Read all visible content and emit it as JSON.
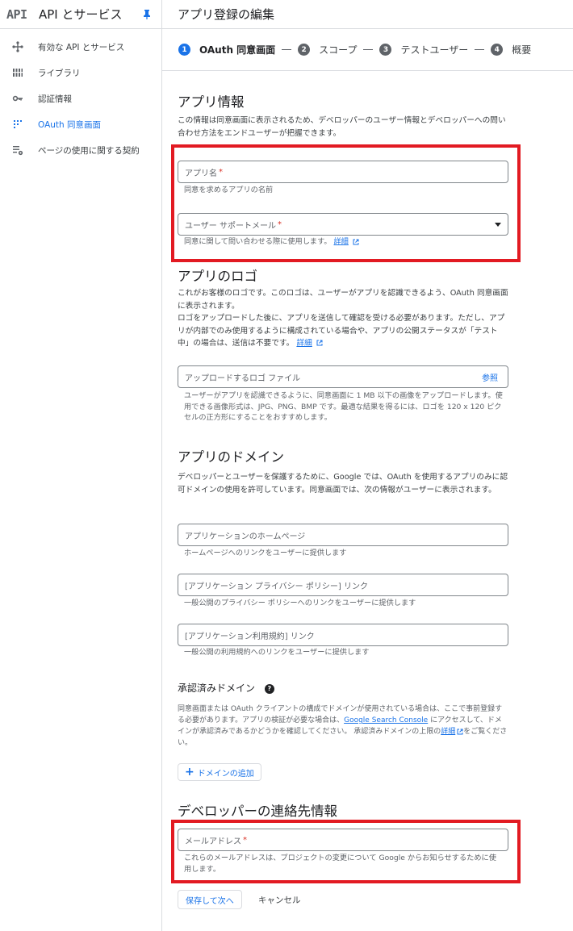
{
  "sidebar": {
    "logo": "API",
    "title": "API とサービス",
    "items": [
      {
        "label": "有効な API とサービス",
        "icon": "diamond-icon",
        "active": false
      },
      {
        "label": "ライブラリ",
        "icon": "library-icon",
        "active": false
      },
      {
        "label": "認証情報",
        "icon": "key-icon",
        "active": false
      },
      {
        "label": "OAuth 同意画面",
        "icon": "consent-icon",
        "active": true
      },
      {
        "label": "ページの使用に関する契約",
        "icon": "settings-list-icon",
        "active": false
      }
    ]
  },
  "header": {
    "title": "アプリ登録の編集"
  },
  "stepper": {
    "steps": [
      {
        "num": "1",
        "label": "OAuth 同意画面"
      },
      {
        "num": "2",
        "label": "スコープ"
      },
      {
        "num": "3",
        "label": "テストユーザー"
      },
      {
        "num": "4",
        "label": "概要"
      }
    ]
  },
  "app_info": {
    "heading": "アプリ情報",
    "desc": "この情報は同意画面に表示されるため、デベロッパーのユーザー情報とデベロッパーへの問い合わせ方法をエンドユーザーが把握できます。",
    "app_name_placeholder": "アプリ名",
    "app_name_hint": "同意を求めるアプリの名前",
    "support_email_placeholder": "ユーザー サポートメール",
    "support_email_hint": "同意に関して問い合わせる際に使用します。",
    "details_link": "詳細",
    "required_mark": "*"
  },
  "app_logo": {
    "heading": "アプリのロゴ",
    "desc_line1": "これがお客様のロゴです。このロゴは、ユーザーがアプリを認識できるよう、OAuth 同意画面に表示されます。",
    "desc_line2": "ロゴをアップロードした後に、アプリを送信して確認を受ける必要があります。ただし、アプリが内部でのみ使用するように構成されている場合や、アプリの公開ステータスが「テスト中」の場合は、送信は不要です。",
    "details_link": "詳細",
    "upload_placeholder": "アップロードするロゴ ファイル",
    "browse": "参照",
    "hint": "ユーザーがアプリを認識できるように、同意画面に 1 MB 以下の画像をアップロードします。使用できる画像形式は、JPG、PNG、BMP です。最適な結果を得るには、ロゴを 120 x 120 ピクセルの正方形にすることをおすすめします。"
  },
  "app_domain": {
    "heading": "アプリのドメイン",
    "desc": "デベロッパーとユーザーを保護するために、Google では、OAuth を使用するアプリのみに認可ドメインの使用を許可しています。同意画面では、次の情報がユーザーに表示されます。",
    "homepage_placeholder": "アプリケーションのホームページ",
    "homepage_hint": "ホームページへのリンクをユーザーに提供します",
    "privacy_placeholder": "[アプリケーション プライバシー ポリシー] リンク",
    "privacy_hint": "一般公開のプライバシー ポリシーへのリンクをユーザーに提供します",
    "tos_placeholder": "[アプリケーション利用規約] リンク",
    "tos_hint": "一般公開の利用規約へのリンクをユーザーに提供します"
  },
  "authorized_domains": {
    "heading": "承認済みドメイン",
    "help": "?",
    "desc_a": "同意画面または OAuth クライアントの構成でドメインが使用されている場合は、ここで事前登録する必要があります。アプリの検証が必要な場合は、",
    "console_link": "Google Search Console",
    "desc_b": " にアクセスして、ドメインが承認済みであるかどうかを確認してください。 承認済みドメインの上限の",
    "details_link": "詳細",
    "desc_c": "をご覧ください。",
    "add_button": "ドメインの追加",
    "add_plus": "+"
  },
  "developer_contact": {
    "heading": "デベロッパーの連絡先情報",
    "email_placeholder": "メールアドレス",
    "email_hint": "これらのメールアドレスは、プロジェクトの変更について Google からお知らせするために使用します。"
  },
  "actions": {
    "save_next": "保存して次へ",
    "cancel": "キャンセル"
  },
  "colors": {
    "accent": "#1a73e8",
    "highlight": "#e21a22",
    "required": "#d93025"
  }
}
